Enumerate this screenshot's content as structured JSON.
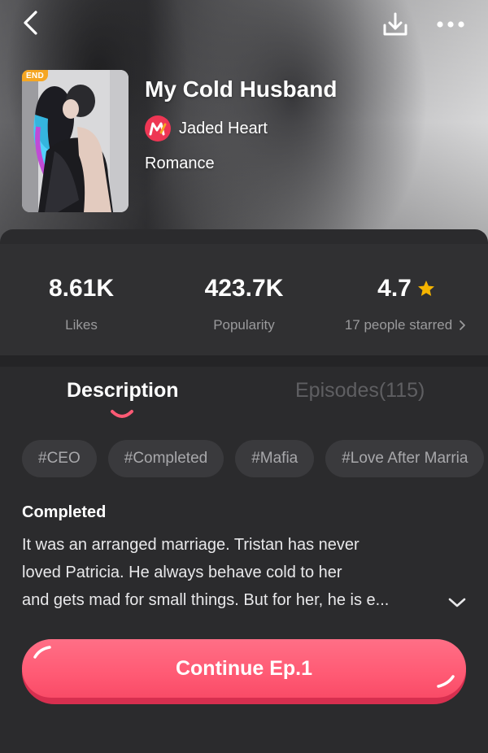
{
  "header": {
    "back_icon": "chevron-left-icon",
    "download_icon": "download-icon",
    "more_icon": "more-dots-icon"
  },
  "book": {
    "badge": "END",
    "title": "My Cold Husband",
    "author": "Jaded Heart",
    "author_badge_letter": "M",
    "genre": "Romance"
  },
  "stats": {
    "likes_value": "8.61K",
    "likes_label": "Likes",
    "popularity_value": "423.7K",
    "popularity_label": "Popularity",
    "rating_value": "4.7",
    "rating_label": "17 people starred"
  },
  "tabs": [
    {
      "label": "Description",
      "active": true
    },
    {
      "label": "Episodes(115)",
      "active": false
    }
  ],
  "tags": [
    "#CEO",
    "#Completed",
    "#Mafia",
    "#Love After Marria"
  ],
  "description": {
    "heading": "Completed",
    "lines": [
      "It was an arranged marriage. Tristan has never",
      "loved Patricia. He always behave cold to her",
      "and gets mad for small things. But for her, he is e..."
    ]
  },
  "cta": {
    "label": "Continue Ep.1"
  },
  "colors": {
    "accent": "#ff5a74",
    "star": "#f5b400",
    "end_badge": "#f5a623",
    "background": "#2b2b2d"
  }
}
